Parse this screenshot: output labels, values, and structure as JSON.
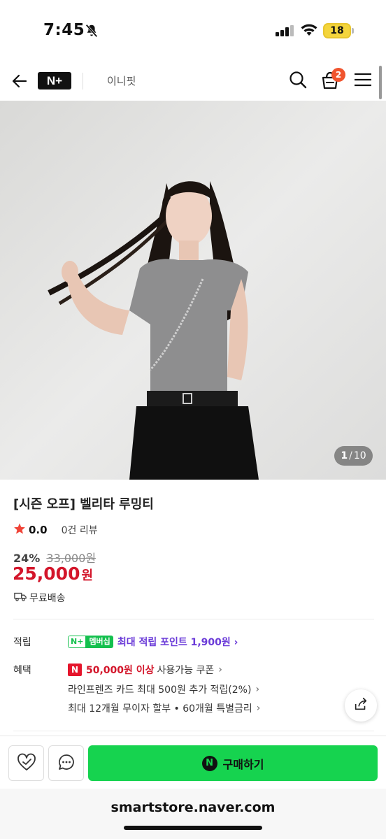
{
  "status_bar": {
    "time": "7:45",
    "battery": "18"
  },
  "nav": {
    "logo": "N+",
    "store_name": "이니핏",
    "cart_count": "2"
  },
  "image": {
    "current": "1",
    "separator": "/",
    "total": "10"
  },
  "product": {
    "title": "[시즌 오프] 벨리타 루밍티",
    "rating": "0.0",
    "review_count": "0건 리뷰",
    "discount": "24%",
    "original_price": "33,000원",
    "price": "25,000",
    "price_unit": "원",
    "shipping": "무료배송"
  },
  "points": {
    "label": "적립",
    "badge_n": "N+",
    "badge_membership": "멤버십",
    "text_prefix": "최대 적립 포인트",
    "amount": "1,900원"
  },
  "benefits": {
    "label": "혜택",
    "coupon_badge": "N",
    "coupon_amount": "50,000원 이상",
    "coupon_text": "사용가능 쿠폰",
    "card_text": "라인프렌즈 카드 최대 500원 추가 적립(2%)",
    "installment_text": "최대 12개월 무이자 할부 • 60개월 특별금리"
  },
  "bottom": {
    "buy_icon": "N",
    "buy_label": "구매하기"
  },
  "browser": {
    "url": "smartstore.naver.com"
  },
  "colors": {
    "brand_green": "#16d34f",
    "price_red": "#d3152a",
    "point_purple": "#6a3ad8"
  }
}
